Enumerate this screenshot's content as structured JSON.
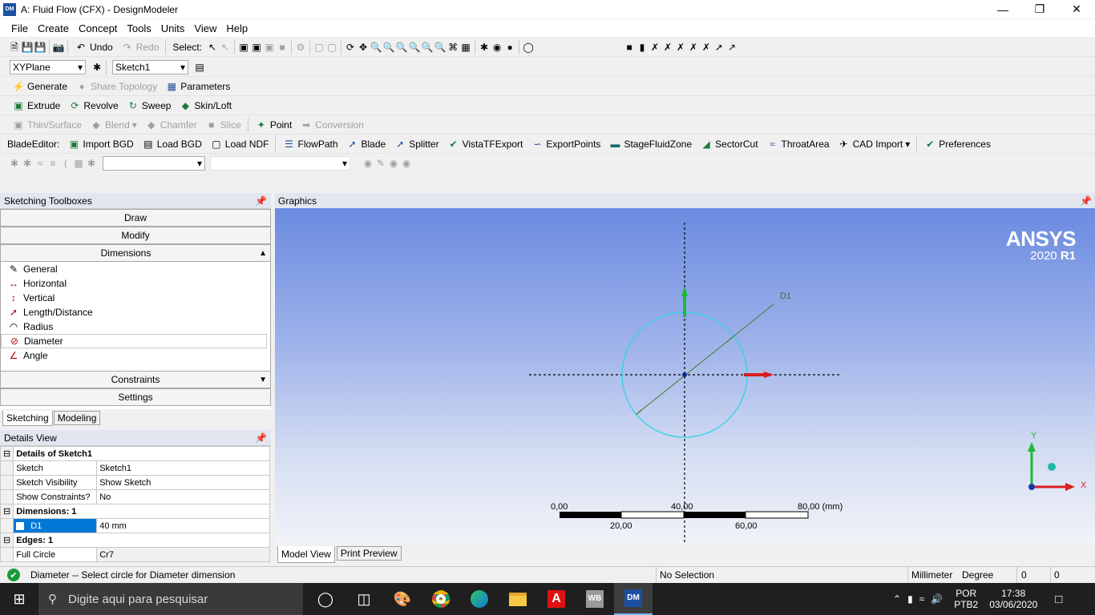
{
  "window": {
    "title": "A: Fluid Flow (CFX) - DesignModeler",
    "app_icon": "DM"
  },
  "menu": [
    "File",
    "Create",
    "Concept",
    "Tools",
    "Units",
    "View",
    "Help"
  ],
  "toolbar1": {
    "undo": "Undo",
    "redo": "Redo",
    "select": "Select:"
  },
  "toolbar2": {
    "plane": "XYPlane",
    "sketch": "Sketch1"
  },
  "toolbar3": {
    "generate": "Generate",
    "share_topology": "Share Topology",
    "parameters": "Parameters"
  },
  "toolbar4": {
    "extrude": "Extrude",
    "revolve": "Revolve",
    "sweep": "Sweep",
    "skin_loft": "Skin/Loft"
  },
  "toolbar5": {
    "thin_surface": "Thin/Surface",
    "blend": "Blend",
    "chamfer": "Chamfer",
    "slice": "Slice",
    "point": "Point",
    "conversion": "Conversion"
  },
  "toolbar6": {
    "blade_editor": "BladeEditor:",
    "import_bgd": "Import BGD",
    "load_bgd": "Load BGD",
    "load_ndf": "Load NDF",
    "flowpath": "FlowPath",
    "blade": "Blade",
    "splitter": "Splitter",
    "vistatf": "VistaTFExport",
    "exportpoints": "ExportPoints",
    "stagefluid": "StageFluidZone",
    "sectorcut": "SectorCut",
    "throatarea": "ThroatArea",
    "cad_import": "CAD Import",
    "preferences": "Preferences"
  },
  "sketching": {
    "header": "Sketching Toolboxes",
    "draw": "Draw",
    "modify": "Modify",
    "dimensions": "Dimensions",
    "tools": [
      "General",
      "Horizontal",
      "Vertical",
      "Length/Distance",
      "Radius",
      "Diameter",
      "Angle"
    ],
    "constraints": "Constraints",
    "settings": "Settings",
    "tab_sketching": "Sketching",
    "tab_modeling": "Modeling"
  },
  "details": {
    "header": "Details View",
    "title": "Details of Sketch1",
    "rows": [
      [
        "Sketch",
        "Sketch1"
      ],
      [
        "Sketch Visibility",
        "Show Sketch"
      ],
      [
        "Show Constraints?",
        "No"
      ]
    ],
    "dim_header": "Dimensions: 1",
    "dim_name": "D1",
    "dim_value": "40 mm",
    "edges_header": "Edges: 1",
    "edge_name": "Full Circle",
    "edge_value": "Cr7"
  },
  "graphics": {
    "header": "Graphics",
    "brand": "ANSYS",
    "version": "2020",
    "release": "R1",
    "dim_label": "D1",
    "axis_x": "X",
    "axis_y": "Y",
    "scale": {
      "t0": "0,00",
      "t40": "40,00",
      "t80": "80,00 (mm)",
      "t20": "20,00",
      "t60": "60,00"
    },
    "tab_model": "Model View",
    "tab_print": "Print Preview"
  },
  "status": {
    "message": "Diameter -- Select circle for Diameter dimension",
    "selection": "No Selection",
    "units": "Millimeter",
    "angle": "Degree",
    "v1": "0",
    "v2": "0"
  },
  "taskbar": {
    "search": "Digite aqui para pesquisar",
    "lang1": "POR",
    "lang2": "PTB2",
    "time": "17:38",
    "date": "03/06/2020"
  }
}
